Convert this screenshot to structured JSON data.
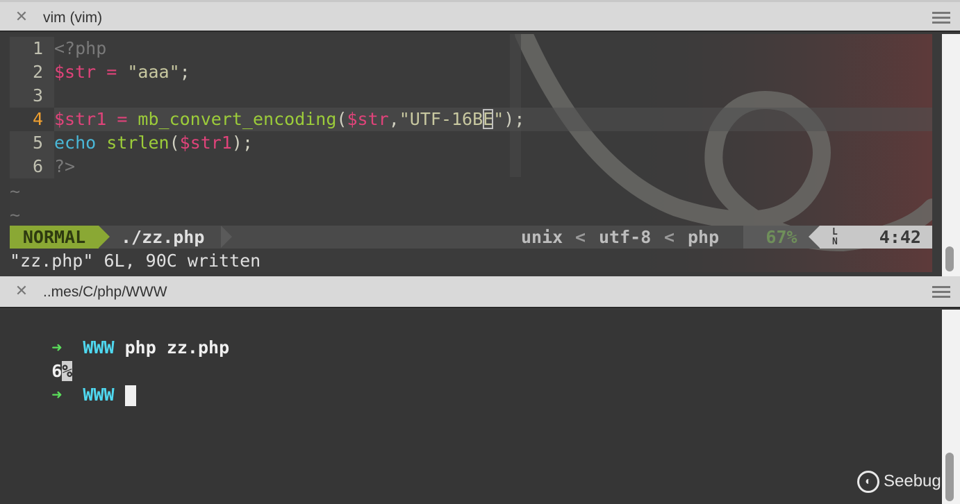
{
  "top_tab": {
    "title": "vim (vim)"
  },
  "bottom_tab": {
    "title": "..mes/C/php/WWW"
  },
  "editor": {
    "lines": [
      {
        "num": "1",
        "tokens": [
          {
            "t": "<?php",
            "c": "c-tag"
          }
        ]
      },
      {
        "num": "2",
        "tokens": [
          {
            "t": "$str",
            "c": "c-var"
          },
          {
            "t": " = ",
            "c": "c-op"
          },
          {
            "t": "\"aaa\"",
            "c": "c-str"
          },
          {
            "t": ";",
            "c": "c-plain"
          }
        ]
      },
      {
        "num": "3",
        "tokens": []
      },
      {
        "num": "4",
        "current": true,
        "tokens": [
          {
            "t": "$str1",
            "c": "c-var"
          },
          {
            "t": " = ",
            "c": "c-op"
          },
          {
            "t": "mb_convert_encoding",
            "c": "c-fn"
          },
          {
            "t": "(",
            "c": "c-paren"
          },
          {
            "t": "$str",
            "c": "c-var"
          },
          {
            "t": ",",
            "c": "c-plain"
          },
          {
            "t": "\"UTF-16B",
            "c": "c-str"
          },
          {
            "t": "E",
            "c": "c-str cursorbox"
          },
          {
            "t": "\"",
            "c": "c-str"
          },
          {
            "t": ");",
            "c": "c-plain"
          }
        ]
      },
      {
        "num": "5",
        "tokens": [
          {
            "t": "echo",
            "c": "c-kw"
          },
          {
            "t": " ",
            "c": "c-plain"
          },
          {
            "t": "strlen",
            "c": "c-fn"
          },
          {
            "t": "(",
            "c": "c-paren"
          },
          {
            "t": "$str1",
            "c": "c-var"
          },
          {
            "t": ");",
            "c": "c-plain"
          }
        ]
      },
      {
        "num": "6",
        "tokens": [
          {
            "t": "?>",
            "c": "c-tag"
          }
        ]
      }
    ],
    "tilde": "~"
  },
  "statusline": {
    "mode": "NORMAL",
    "filename": "./zz.php",
    "fileformat": "unix",
    "encoding": "utf-8",
    "filetype": "php",
    "percent": "67%",
    "ln_icon": "LN",
    "position": "4:42"
  },
  "cmdline": "\"zz.php\" 6L, 90C written",
  "terminal": {
    "prompt_arrow": "➜",
    "dir": "WWW",
    "command": "php zz.php",
    "output": "6",
    "pct": "%"
  },
  "logo": {
    "text": "Seebug"
  }
}
